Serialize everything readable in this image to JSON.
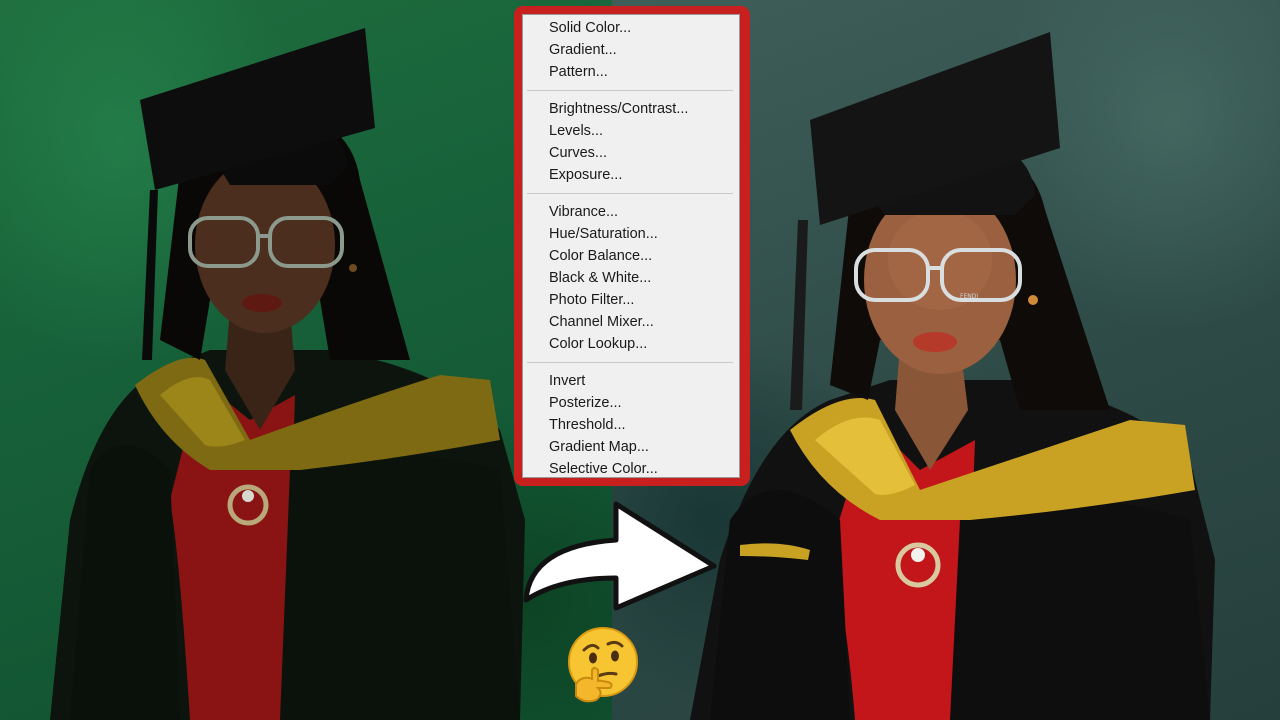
{
  "menu": {
    "groups": [
      [
        "Solid Color...",
        "Gradient...",
        "Pattern..."
      ],
      [
        "Brightness/Contrast...",
        "Levels...",
        "Curves...",
        "Exposure..."
      ],
      [
        "Vibrance...",
        "Hue/Saturation...",
        "Color Balance...",
        "Black & White...",
        "Photo Filter...",
        "Channel Mixer...",
        "Color Lookup..."
      ],
      [
        "Invert",
        "Posterize...",
        "Threshold...",
        "Gradient Map...",
        "Selective Color..."
      ]
    ]
  },
  "glasses_brand": "FENDI",
  "icons": {
    "arrow": "right-arrow-icon",
    "emoji": "thinking-face-icon"
  },
  "colors": {
    "menu_frame": "#c81f1f",
    "menu_bg": "#f0f0f0",
    "before_bg": "#17613a",
    "after_bg": "#2f4c48"
  }
}
